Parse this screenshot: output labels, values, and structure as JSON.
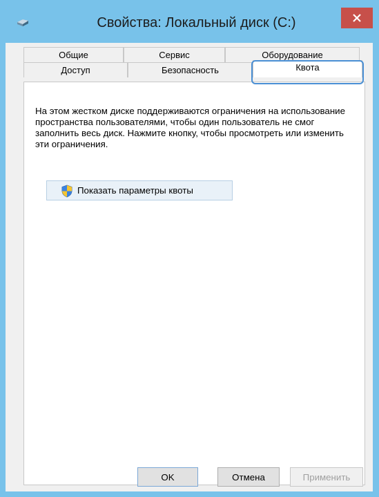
{
  "window": {
    "title": "Свойства: Локальный диск (C:)",
    "close_label": "✕"
  },
  "tabs": {
    "row1": [
      {
        "label": "Общие"
      },
      {
        "label": "Сервис"
      },
      {
        "label": "Оборудование"
      }
    ],
    "row2": [
      {
        "label": "Доступ"
      },
      {
        "label": "Безопасность"
      },
      {
        "label": "Квота"
      }
    ],
    "active": "Квота"
  },
  "quota": {
    "description": "На этом жестком диске поддерживаются ограничения на использование пространства пользователями, чтобы один пользователь не смог заполнить весь диск. Нажмите кнопку, чтобы просмотреть или изменить эти ограничения.",
    "button_label": "Показать параметры квоты"
  },
  "footer": {
    "ok_label": "OK",
    "cancel_label": "Отмена",
    "apply_label": "Применить"
  },
  "colors": {
    "frame": "#78c2ea",
    "close_button": "#c7504a",
    "focus_ring": "#4a8fd4"
  }
}
